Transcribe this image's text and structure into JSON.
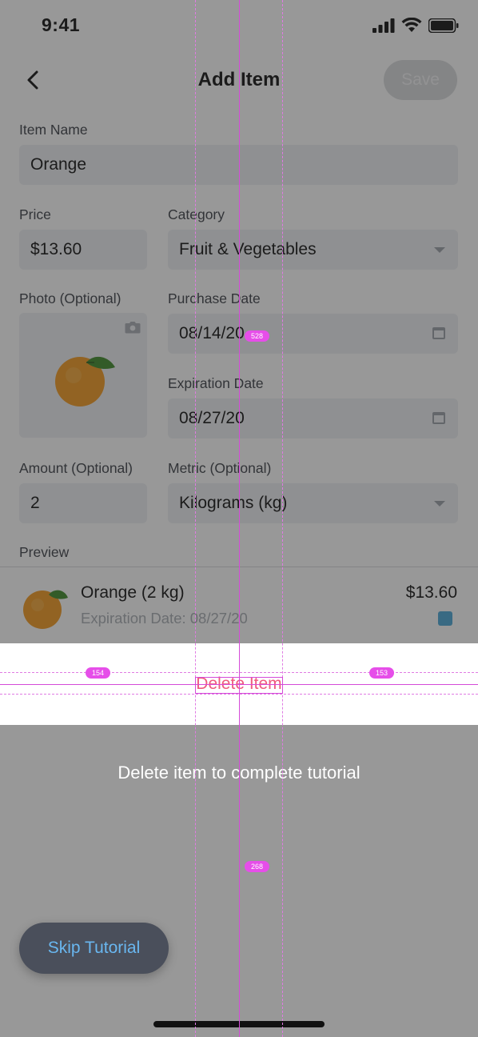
{
  "status_bar": {
    "time": "9:41"
  },
  "nav": {
    "title": "Add Item",
    "save_label": "Save"
  },
  "form": {
    "item_name_label": "Item Name",
    "item_name_value": "Orange",
    "price_label": "Price",
    "price_value": "$13.60",
    "category_label": "Category",
    "category_value": "Fruit & Vegetables",
    "photo_label": "Photo (Optional)",
    "purchase_date_label": "Purchase Date",
    "purchase_date_value": "08/14/20",
    "expiration_date_label": "Expiration Date",
    "expiration_date_value": "08/27/20",
    "amount_label": "Amount (Optional)",
    "amount_value": "2",
    "metric_label": "Metric (Optional)",
    "metric_value": "Kilograms (kg)"
  },
  "preview": {
    "label": "Preview",
    "name": "Orange (2 kg)",
    "expiration": "Expiration Date: 08/27/20",
    "price": "$13.60",
    "swatch_color": "#4aa8d6"
  },
  "tutorial": {
    "delete_label": "Delete Item",
    "instruction": "Delete item to complete tutorial",
    "skip_label": "Skip Tutorial"
  },
  "guides": {
    "top_gap": "528",
    "left_gap": "154",
    "right_gap": "153",
    "bottom_gap": "268"
  },
  "colors": {
    "delete_red": "#ef5b7e",
    "skip_blue": "#69b7f0",
    "guide_magenta": "#e64ee9"
  }
}
